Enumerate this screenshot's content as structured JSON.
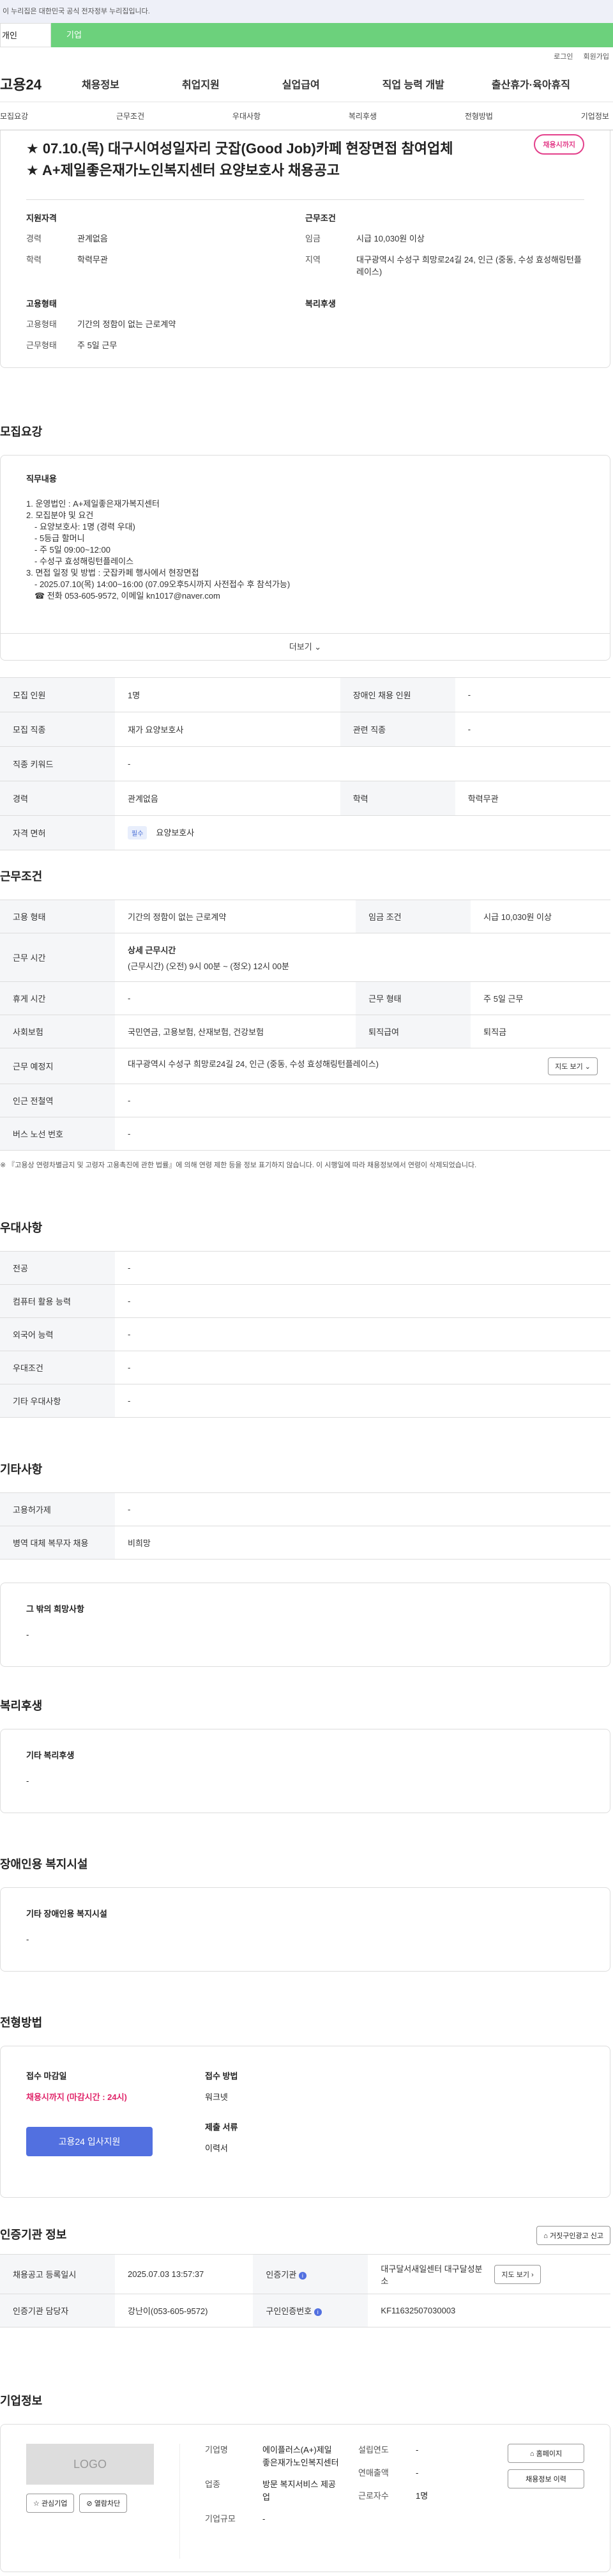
{
  "gov_notice": "이 누리집은 대한민국 공식 전자정부 누리집입니다.",
  "tabs": {
    "person": "개인",
    "company": "기업"
  },
  "util": {
    "login": "로그인",
    "join": "회원가입"
  },
  "gnb": {
    "logo": "고용24",
    "items": [
      "채용정보",
      "취업지원",
      "실업급여",
      "직업 능력 개발",
      "출산휴가·육아휴직"
    ]
  },
  "subnav": [
    "모집요강",
    "근무조건",
    "우대사항",
    "복리후생",
    "전형방법",
    "기업정보"
  ],
  "header": {
    "badge": "채용시까지",
    "title_line1": "★ 07.10.(목) 대구시여성일자리 굿잡(Good Job)카페 현장면접 참여업체",
    "title_line2": "★ A+제일좋은재가노인복지센터 요양보호사 채용공고",
    "qual_label": "지원자격",
    "cond_label": "근무조건",
    "career_k": "경력",
    "career_v": "관계없음",
    "edu_k": "학력",
    "edu_v": "학력무관",
    "pay_k": "임금",
    "pay_v": "시급 10,030원 이상",
    "region_k": "지역",
    "region_v": "대구광역시 수성구 희망로24길 24, 인근 (중동, 수성 효성해링턴플레이스)",
    "emp_label": "고용형태",
    "welfare_label": "복리후생",
    "etype_k": "고용형태",
    "etype_v": "기간의 정함이 없는 근로계약",
    "wtype_k": "근무형태",
    "wtype_v": "주 5일 근무"
  },
  "recruit": {
    "title": "모집요강",
    "desc_label": "직무내용",
    "lines": [
      "1. 운영법인 : A+제일좋은재가복지센터",
      "2. 모집분야 및 요건",
      "　- 요양보호사: 1명 (경력 우대)",
      "　- 5등급 할머니",
      "　- 주 5일 09:00~12:00",
      "　- 수성구 효성해링턴플레이스",
      "3. 면접 일정 및 방법 : 굿잡카페 행사에서 현장면접",
      "　- 2025.07.10(목) 14:00~16:00 (07.09오후5시까지 사전접수 후 참석가능)",
      "　☎ 전화 053-605-9572, 이메일 kn1017@naver.com"
    ],
    "more": "더보기",
    "rows": [
      [
        "모집 인원",
        "1명",
        "장애인 채용 인원",
        "-"
      ],
      [
        "모집 직종",
        "재가 요양보호사",
        "관련 직종",
        "-"
      ],
      [
        "직종 키워드",
        "-"
      ],
      [
        "경력",
        "관계없음",
        "학력",
        "학력무관"
      ]
    ],
    "license_k": "자격 면허",
    "license_tag": "필수",
    "license_v": "요양보호사"
  },
  "cond": {
    "title": "근무조건",
    "etype_k": "고용 형태",
    "etype_v": "기간의 정함이 없는 근로계약",
    "pay_k": "임금 조건",
    "pay_v": "시급 10,030원 이상",
    "time_k": "근무 시간",
    "time_h": "상세 근무시간",
    "time_v": "(근무시간) (오전) 9시 00분 ~ (정오) 12시 00분",
    "rest_k": "휴게 시간",
    "rest_v": "-",
    "work_k": "근무 형태",
    "work_v": "주 5일 근무",
    "ins_k": "사회보험",
    "ins_v": "국민연금, 고용보험, 산재보험, 건강보험",
    "sev_k": "퇴직급여",
    "sev_v": "퇴직금",
    "place_k": "근무 예정지",
    "place_v": "대구광역시 수성구 희망로24길 24, 인근 (중동, 수성 효성해링턴플레이스)",
    "map_btn": "지도 보기",
    "sub_k": "인근 전철역",
    "sub_v": "-",
    "bus_k": "버스 노선 번호",
    "bus_v": "-",
    "note": "※ 『고용상 연령차별금지 및 고령자 고용촉진에 관한 법률』에 의해 연령 제한 등을 정보 표기하지 않습니다. 이 시행일에 따라 채용정보에서 연령이 삭제되었습니다."
  },
  "pref": {
    "title": "우대사항",
    "rows": [
      [
        "전공",
        "-"
      ],
      [
        "컴퓨터 활용 능력",
        "-"
      ],
      [
        "외국어 능력",
        "-"
      ],
      [
        "우대조건",
        "-"
      ],
      [
        "기타 우대사항",
        "-"
      ]
    ]
  },
  "etc": {
    "title": "기타사항",
    "rows": [
      [
        "고용허가제",
        "-"
      ],
      [
        "병역 대체 복무자 채용",
        "비희망"
      ]
    ],
    "other_label": "그 밖의 희망사항",
    "other_v": "-"
  },
  "welfare": {
    "title": "복리후생",
    "label": "기타 복리후생",
    "v": "-"
  },
  "disab": {
    "title": "장애인용 복지시설",
    "label": "기타 장애인용 복지시설",
    "v": "-"
  },
  "process": {
    "title": "전형방법",
    "deadline_k": "접수 마감일",
    "deadline_v": "채용시까지 (마감시간 : 24시)",
    "method_k": "접수 방법",
    "method_v": "워크넷",
    "docs_k": "제출 서류",
    "docs_v": "이력서",
    "apply": "고용24 입사지원"
  },
  "agency": {
    "title": "인증기관 정보",
    "report_btn": "거짓구인광고 신고",
    "reg_k": "채용공고 등록일시",
    "reg_v": "2025.07.03 13:57:37",
    "org_k": "인증기관",
    "org_v": "대구달서새일센터 대구달성분소",
    "map_btn": "지도 보기",
    "mgr_k": "인증기관 담당자",
    "mgr_v": "강난이(053-605-9572)",
    "id_k": "구인인증번호",
    "id_v": "KF11632507030003"
  },
  "company": {
    "title": "기업정보",
    "logo": "LOGO",
    "fav": "관심기업",
    "block": "열람차단",
    "name_k": "기업명",
    "name_v": "에이플러스(A+)제일좋은재가노인복지센터",
    "year_k": "설립연도",
    "year_v": "-",
    "sales_k": "연매출액",
    "sales_v": "-",
    "emp_k": "근로자수",
    "emp_v": "1명",
    "ind_k": "업종",
    "ind_v": "방문 복지서비스 제공업",
    "size_k": "기업규모",
    "size_v": "-",
    "home_btn": "홈페이지",
    "jobs_btn": "채용정보 이력"
  }
}
